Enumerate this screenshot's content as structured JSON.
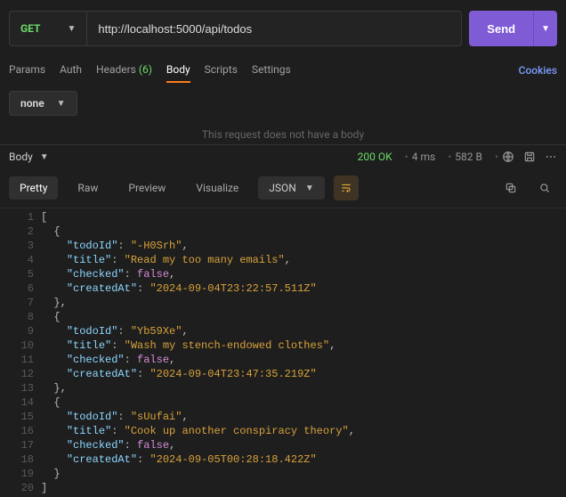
{
  "request": {
    "method": "GET",
    "url": "http://localhost:5000/api/todos",
    "send_label": "Send"
  },
  "req_tabs": {
    "params": "Params",
    "auth": "Auth",
    "headers": "Headers",
    "headers_count": "(6)",
    "body": "Body",
    "scripts": "Scripts",
    "settings": "Settings",
    "cookies": "Cookies"
  },
  "body_type": {
    "selected": "none",
    "empty_msg": "This request does not have a body"
  },
  "response": {
    "label": "Body",
    "status_code": "200",
    "status_text": "OK",
    "time": "4 ms",
    "size": "582 B"
  },
  "view_tabs": {
    "pretty": "Pretty",
    "raw": "Raw",
    "preview": "Preview",
    "visualize": "Visualize",
    "format": "JSON"
  },
  "code": [
    {
      "ln": 1,
      "indent": 0,
      "k": "punc",
      "t": "["
    },
    {
      "ln": 2,
      "indent": 2,
      "k": "punc",
      "t": "{"
    },
    {
      "ln": 3,
      "indent": 4,
      "key": "todoId",
      "vt": "str",
      "v": "-H0Srh",
      "comma": true
    },
    {
      "ln": 4,
      "indent": 4,
      "key": "title",
      "vt": "str",
      "v": "Read my too many emails",
      "comma": true
    },
    {
      "ln": 5,
      "indent": 4,
      "key": "checked",
      "vt": "bool",
      "v": "false",
      "comma": true
    },
    {
      "ln": 6,
      "indent": 4,
      "key": "createdAt",
      "vt": "str",
      "v": "2024-09-04T23:22:57.511Z"
    },
    {
      "ln": 7,
      "indent": 2,
      "k": "punc",
      "t": "},"
    },
    {
      "ln": 8,
      "indent": 2,
      "k": "punc",
      "t": "{"
    },
    {
      "ln": 9,
      "indent": 4,
      "key": "todoId",
      "vt": "str",
      "v": "Yb59Xe",
      "comma": true
    },
    {
      "ln": 10,
      "indent": 4,
      "key": "title",
      "vt": "str",
      "v": "Wash my stench-endowed clothes",
      "comma": true
    },
    {
      "ln": 11,
      "indent": 4,
      "key": "checked",
      "vt": "bool",
      "v": "false",
      "comma": true
    },
    {
      "ln": 12,
      "indent": 4,
      "key": "createdAt",
      "vt": "str",
      "v": "2024-09-04T23:47:35.219Z"
    },
    {
      "ln": 13,
      "indent": 2,
      "k": "punc",
      "t": "},"
    },
    {
      "ln": 14,
      "indent": 2,
      "k": "punc",
      "t": "{"
    },
    {
      "ln": 15,
      "indent": 4,
      "key": "todoId",
      "vt": "str",
      "v": "sUufai",
      "comma": true
    },
    {
      "ln": 16,
      "indent": 4,
      "key": "title",
      "vt": "str",
      "v": "Cook up another conspiracy theory",
      "comma": true
    },
    {
      "ln": 17,
      "indent": 4,
      "key": "checked",
      "vt": "bool",
      "v": "false",
      "comma": true
    },
    {
      "ln": 18,
      "indent": 4,
      "key": "createdAt",
      "vt": "str",
      "v": "2024-09-05T00:28:18.422Z"
    },
    {
      "ln": 19,
      "indent": 2,
      "k": "punc",
      "t": "}"
    },
    {
      "ln": 20,
      "indent": 0,
      "k": "punc",
      "t": "]"
    }
  ]
}
